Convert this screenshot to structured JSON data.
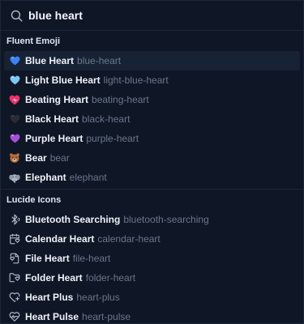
{
  "search": {
    "value": "blue heart",
    "icon": "search-icon"
  },
  "sections": [
    {
      "title": "Fluent Emoji",
      "items": [
        {
          "label": "Blue Heart",
          "slug": "blue-heart",
          "icon": "blue-heart-emoji",
          "color": "#3b82f6"
        },
        {
          "label": "Light Blue Heart",
          "slug": "light-blue-heart",
          "icon": "light-blue-heart-emoji",
          "color": "#7cc7f2"
        },
        {
          "label": "Beating Heart",
          "slug": "beating-heart",
          "icon": "beating-heart-emoji",
          "color": "#e8336a"
        },
        {
          "label": "Black Heart",
          "slug": "black-heart",
          "icon": "black-heart-emoji",
          "color": "#2a2a34"
        },
        {
          "label": "Purple Heart",
          "slug": "purple-heart",
          "icon": "purple-heart-emoji",
          "color": "#a54fd6"
        },
        {
          "label": "Bear",
          "slug": "bear",
          "icon": "bear-emoji",
          "color": "#b06a3b"
        },
        {
          "label": "Elephant",
          "slug": "elephant",
          "icon": "elephant-emoji",
          "color": "#a6b3c4"
        }
      ]
    },
    {
      "title": "Lucide Icons",
      "items": [
        {
          "label": "Bluetooth Searching",
          "slug": "bluetooth-searching",
          "icon": "bluetooth-searching-icon"
        },
        {
          "label": "Calendar Heart",
          "slug": "calendar-heart",
          "icon": "calendar-heart-icon"
        },
        {
          "label": "File Heart",
          "slug": "file-heart",
          "icon": "file-heart-icon"
        },
        {
          "label": "Folder Heart",
          "slug": "folder-heart",
          "icon": "folder-heart-icon"
        },
        {
          "label": "Heart Plus",
          "slug": "heart-plus",
          "icon": "heart-plus-icon"
        },
        {
          "label": "Heart Pulse",
          "slug": "heart-pulse",
          "icon": "heart-pulse-icon"
        }
      ]
    }
  ],
  "colors": {
    "background": "#0f1626",
    "selected_row": "#172235",
    "slug_text": "#6b778c",
    "icon_stroke": "#aeb8c8"
  }
}
